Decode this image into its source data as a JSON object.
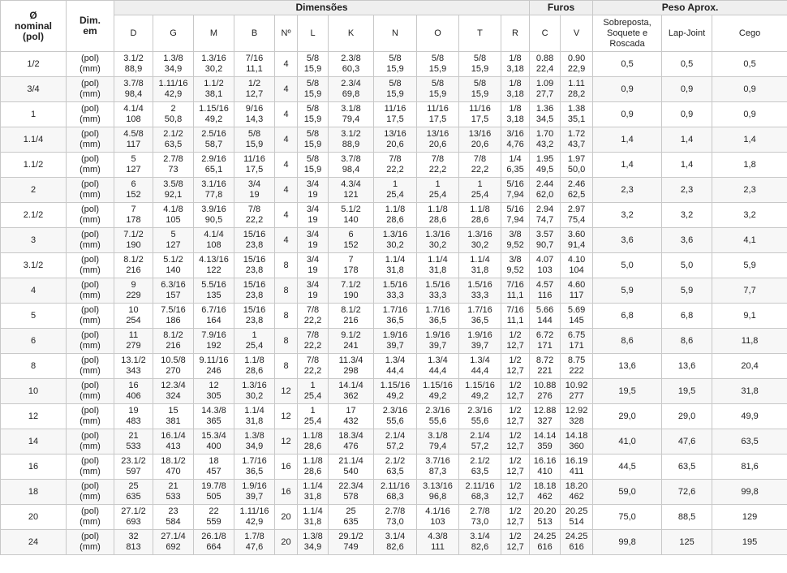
{
  "header": {
    "nominal": "Ø\nnominal\n(pol)",
    "dim": "Dim.\nem",
    "group_dimensoes": "Dimensões",
    "group_furos": "Furos",
    "group_peso": "Peso Aprox.",
    "dim_cols": [
      "D",
      "G",
      "M",
      "B",
      "Nº",
      "L",
      "K",
      "N",
      "O",
      "T",
      "R"
    ],
    "furo_cols": [
      "C",
      "V"
    ],
    "peso_cols": [
      "Sobreposta,\nSoquete e\nRoscada",
      "Lap-Joint",
      "Cego"
    ]
  },
  "units": [
    "(pol)",
    "(mm)"
  ],
  "rows": [
    {
      "n": "1/2",
      "D": [
        "3.1/2",
        "88,9"
      ],
      "G": [
        "1.3/8",
        "34,9"
      ],
      "M": [
        "1.3/16",
        "30,2"
      ],
      "B": [
        "7/16",
        "11,1"
      ],
      "No": "4",
      "L": [
        "5/8",
        "15,9"
      ],
      "K": [
        "2.3/8",
        "60,3"
      ],
      "N": [
        "5/8",
        "15,9"
      ],
      "O": [
        "5/8",
        "15,9"
      ],
      "T": [
        "5/8",
        "15,9"
      ],
      "R": [
        "1/8",
        "3,18"
      ],
      "C": [
        "0.88",
        "22,4"
      ],
      "V": [
        "0.90",
        "22,9"
      ],
      "p1": "0,5",
      "p2": "0,5",
      "p3": "0,5"
    },
    {
      "n": "3/4",
      "D": [
        "3.7/8",
        "98,4"
      ],
      "G": [
        "1.11/16",
        "42,9"
      ],
      "M": [
        "1.1/2",
        "38,1"
      ],
      "B": [
        "1/2",
        "12,7"
      ],
      "No": "4",
      "L": [
        "5/8",
        "15,9"
      ],
      "K": [
        "2.3/4",
        "69,8"
      ],
      "N": [
        "5/8",
        "15,9"
      ],
      "O": [
        "5/8",
        "15,9"
      ],
      "T": [
        "5/8",
        "15,9"
      ],
      "R": [
        "1/8",
        "3,18"
      ],
      "C": [
        "1.09",
        "27,7"
      ],
      "V": [
        "1.11",
        "28,2"
      ],
      "p1": "0,9",
      "p2": "0,9",
      "p3": "0,9"
    },
    {
      "n": "1",
      "D": [
        "4.1/4",
        "108"
      ],
      "G": [
        "2",
        "50,8"
      ],
      "M": [
        "1.15/16",
        "49,2"
      ],
      "B": [
        "9/16",
        "14,3"
      ],
      "No": "4",
      "L": [
        "5/8",
        "15,9"
      ],
      "K": [
        "3.1/8",
        "79,4"
      ],
      "N": [
        "11/16",
        "17,5"
      ],
      "O": [
        "11/16",
        "17,5"
      ],
      "T": [
        "11/16",
        "17,5"
      ],
      "R": [
        "1/8",
        "3,18"
      ],
      "C": [
        "1.36",
        "34,5"
      ],
      "V": [
        "1.38",
        "35,1"
      ],
      "p1": "0,9",
      "p2": "0,9",
      "p3": "0,9"
    },
    {
      "n": "1.1/4",
      "D": [
        "4.5/8",
        "117"
      ],
      "G": [
        "2.1/2",
        "63,5"
      ],
      "M": [
        "2.5/16",
        "58,7"
      ],
      "B": [
        "5/8",
        "15,9"
      ],
      "No": "4",
      "L": [
        "5/8",
        "15,9"
      ],
      "K": [
        "3.1/2",
        "88,9"
      ],
      "N": [
        "13/16",
        "20,6"
      ],
      "O": [
        "13/16",
        "20,6"
      ],
      "T": [
        "13/16",
        "20,6"
      ],
      "R": [
        "3/16",
        "4,76"
      ],
      "C": [
        "1.70",
        "43,2"
      ],
      "V": [
        "1.72",
        "43,7"
      ],
      "p1": "1,4",
      "p2": "1,4",
      "p3": "1,4"
    },
    {
      "n": "1.1/2",
      "D": [
        "5",
        "127"
      ],
      "G": [
        "2.7/8",
        "73"
      ],
      "M": [
        "2.9/16",
        "65,1"
      ],
      "B": [
        "11/16",
        "17,5"
      ],
      "No": "4",
      "L": [
        "5/8",
        "15,9"
      ],
      "K": [
        "3.7/8",
        "98,4"
      ],
      "N": [
        "7/8",
        "22,2"
      ],
      "O": [
        "7/8",
        "22,2"
      ],
      "T": [
        "7/8",
        "22,2"
      ],
      "R": [
        "1/4",
        "6,35"
      ],
      "C": [
        "1.95",
        "49,5"
      ],
      "V": [
        "1.97",
        "50,0"
      ],
      "p1": "1,4",
      "p2": "1,4",
      "p3": "1,8"
    },
    {
      "n": "2",
      "D": [
        "6",
        "152"
      ],
      "G": [
        "3.5/8",
        "92,1"
      ],
      "M": [
        "3.1/16",
        "77,8"
      ],
      "B": [
        "3/4",
        "19"
      ],
      "No": "4",
      "L": [
        "3/4",
        "19"
      ],
      "K": [
        "4.3/4",
        "121"
      ],
      "N": [
        "1",
        "25,4"
      ],
      "O": [
        "1",
        "25,4"
      ],
      "T": [
        "1",
        "25,4"
      ],
      "R": [
        "5/16",
        "7,94"
      ],
      "C": [
        "2.44",
        "62,0"
      ],
      "V": [
        "2.46",
        "62,5"
      ],
      "p1": "2,3",
      "p2": "2,3",
      "p3": "2,3"
    },
    {
      "n": "2.1/2",
      "D": [
        "7",
        "178"
      ],
      "G": [
        "4.1/8",
        "105"
      ],
      "M": [
        "3.9/16",
        "90,5"
      ],
      "B": [
        "7/8",
        "22,2"
      ],
      "No": "4",
      "L": [
        "3/4",
        "19"
      ],
      "K": [
        "5.1/2",
        "140"
      ],
      "N": [
        "1.1/8",
        "28,6"
      ],
      "O": [
        "1.1/8",
        "28,6"
      ],
      "T": [
        "1.1/8",
        "28,6"
      ],
      "R": [
        "5/16",
        "7,94"
      ],
      "C": [
        "2.94",
        "74,7"
      ],
      "V": [
        "2.97",
        "75,4"
      ],
      "p1": "3,2",
      "p2": "3,2",
      "p3": "3,2"
    },
    {
      "n": "3",
      "D": [
        "7.1/2",
        "190"
      ],
      "G": [
        "5",
        "127"
      ],
      "M": [
        "4.1/4",
        "108"
      ],
      "B": [
        "15/16",
        "23,8"
      ],
      "No": "4",
      "L": [
        "3/4",
        "19"
      ],
      "K": [
        "6",
        "152"
      ],
      "N": [
        "1.3/16",
        "30,2"
      ],
      "O": [
        "1.3/16",
        "30,2"
      ],
      "T": [
        "1.3/16",
        "30,2"
      ],
      "R": [
        "3/8",
        "9,52"
      ],
      "C": [
        "3.57",
        "90,7"
      ],
      "V": [
        "3.60",
        "91,4"
      ],
      "p1": "3,6",
      "p2": "3,6",
      "p3": "4,1"
    },
    {
      "n": "3.1/2",
      "D": [
        "8.1/2",
        "216"
      ],
      "G": [
        "5.1/2",
        "140"
      ],
      "M": [
        "4.13/16",
        "122"
      ],
      "B": [
        "15/16",
        "23,8"
      ],
      "No": "8",
      "L": [
        "3/4",
        "19"
      ],
      "K": [
        "7",
        "178"
      ],
      "N": [
        "1.1/4",
        "31,8"
      ],
      "O": [
        "1.1/4",
        "31,8"
      ],
      "T": [
        "1.1/4",
        "31,8"
      ],
      "R": [
        "3/8",
        "9,52"
      ],
      "C": [
        "4.07",
        "103"
      ],
      "V": [
        "4.10",
        "104"
      ],
      "p1": "5,0",
      "p2": "5,0",
      "p3": "5,9"
    },
    {
      "n": "4",
      "D": [
        "9",
        "229"
      ],
      "G": [
        "6.3/16",
        "157"
      ],
      "M": [
        "5.5/16",
        "135"
      ],
      "B": [
        "15/16",
        "23,8"
      ],
      "No": "8",
      "L": [
        "3/4",
        "19"
      ],
      "K": [
        "7.1/2",
        "190"
      ],
      "N": [
        "1.5/16",
        "33,3"
      ],
      "O": [
        "1.5/16",
        "33,3"
      ],
      "T": [
        "1.5/16",
        "33,3"
      ],
      "R": [
        "7/16",
        "11,1"
      ],
      "C": [
        "4.57",
        "116"
      ],
      "V": [
        "4.60",
        "117"
      ],
      "p1": "5,9",
      "p2": "5,9",
      "p3": "7,7"
    },
    {
      "n": "5",
      "D": [
        "10",
        "254"
      ],
      "G": [
        "7.5/16",
        "186"
      ],
      "M": [
        "6.7/16",
        "164"
      ],
      "B": [
        "15/16",
        "23,8"
      ],
      "No": "8",
      "L": [
        "7/8",
        "22,2"
      ],
      "K": [
        "8.1/2",
        "216"
      ],
      "N": [
        "1.7/16",
        "36,5"
      ],
      "O": [
        "1.7/16",
        "36,5"
      ],
      "T": [
        "1.7/16",
        "36,5"
      ],
      "R": [
        "7/16",
        "11,1"
      ],
      "C": [
        "5.66",
        "144"
      ],
      "V": [
        "5.69",
        "145"
      ],
      "p1": "6,8",
      "p2": "6,8",
      "p3": "9,1"
    },
    {
      "n": "6",
      "D": [
        "11",
        "279"
      ],
      "G": [
        "8.1/2",
        "216"
      ],
      "M": [
        "7.9/16",
        "192"
      ],
      "B": [
        "1",
        "25,4"
      ],
      "No": "8",
      "L": [
        "7/8",
        "22,2"
      ],
      "K": [
        "9.1/2",
        "241"
      ],
      "N": [
        "1.9/16",
        "39,7"
      ],
      "O": [
        "1.9/16",
        "39,7"
      ],
      "T": [
        "1.9/16",
        "39,7"
      ],
      "R": [
        "1/2",
        "12,7"
      ],
      "C": [
        "6.72",
        "171"
      ],
      "V": [
        "6.75",
        "171"
      ],
      "p1": "8,6",
      "p2": "8,6",
      "p3": "11,8"
    },
    {
      "n": "8",
      "D": [
        "13.1/2",
        "343"
      ],
      "G": [
        "10.5/8",
        "270"
      ],
      "M": [
        "9.11/16",
        "246"
      ],
      "B": [
        "1.1/8",
        "28,6"
      ],
      "No": "8",
      "L": [
        "7/8",
        "22,2"
      ],
      "K": [
        "11.3/4",
        "298"
      ],
      "N": [
        "1.3/4",
        "44,4"
      ],
      "O": [
        "1.3/4",
        "44,4"
      ],
      "T": [
        "1.3/4",
        "44,4"
      ],
      "R": [
        "1/2",
        "12,7"
      ],
      "C": [
        "8.72",
        "221"
      ],
      "V": [
        "8.75",
        "222"
      ],
      "p1": "13,6",
      "p2": "13,6",
      "p3": "20,4"
    },
    {
      "n": "10",
      "D": [
        "16",
        "406"
      ],
      "G": [
        "12.3/4",
        "324"
      ],
      "M": [
        "12",
        "305"
      ],
      "B": [
        "1.3/16",
        "30,2"
      ],
      "No": "12",
      "L": [
        "1",
        "25,4"
      ],
      "K": [
        "14.1/4",
        "362"
      ],
      "N": [
        "1.15/16",
        "49,2"
      ],
      "O": [
        "1.15/16",
        "49,2"
      ],
      "T": [
        "1.15/16",
        "49,2"
      ],
      "R": [
        "1/2",
        "12,7"
      ],
      "C": [
        "10.88",
        "276"
      ],
      "V": [
        "10.92",
        "277"
      ],
      "p1": "19,5",
      "p2": "19,5",
      "p3": "31,8"
    },
    {
      "n": "12",
      "D": [
        "19",
        "483"
      ],
      "G": [
        "15",
        "381"
      ],
      "M": [
        "14.3/8",
        "365"
      ],
      "B": [
        "1.1/4",
        "31,8"
      ],
      "No": "12",
      "L": [
        "1",
        "25,4"
      ],
      "K": [
        "17",
        "432"
      ],
      "N": [
        "2.3/16",
        "55,6"
      ],
      "O": [
        "2.3/16",
        "55,6"
      ],
      "T": [
        "2.3/16",
        "55,6"
      ],
      "R": [
        "1/2",
        "12,7"
      ],
      "C": [
        "12.88",
        "327"
      ],
      "V": [
        "12.92",
        "328"
      ],
      "p1": "29,0",
      "p2": "29,0",
      "p3": "49,9"
    },
    {
      "n": "14",
      "D": [
        "21",
        "533"
      ],
      "G": [
        "16.1/4",
        "413"
      ],
      "M": [
        "15.3/4",
        "400"
      ],
      "B": [
        "1.3/8",
        "34,9"
      ],
      "No": "12",
      "L": [
        "1.1/8",
        "28,6"
      ],
      "K": [
        "18.3/4",
        "476"
      ],
      "N": [
        "2.1/4",
        "57,2"
      ],
      "O": [
        "3.1/8",
        "79,4"
      ],
      "T": [
        "2.1/4",
        "57,2"
      ],
      "R": [
        "1/2",
        "12,7"
      ],
      "C": [
        "14.14",
        "359"
      ],
      "V": [
        "14.18",
        "360"
      ],
      "p1": "41,0",
      "p2": "47,6",
      "p3": "63,5"
    },
    {
      "n": "16",
      "D": [
        "23.1/2",
        "597"
      ],
      "G": [
        "18.1/2",
        "470"
      ],
      "M": [
        "18",
        "457"
      ],
      "B": [
        "1.7/16",
        "36,5"
      ],
      "No": "16",
      "L": [
        "1.1/8",
        "28,6"
      ],
      "K": [
        "21.1/4",
        "540"
      ],
      "N": [
        "2.1/2",
        "63,5"
      ],
      "O": [
        "3.7/16",
        "87,3"
      ],
      "T": [
        "2.1/2",
        "63,5"
      ],
      "R": [
        "1/2",
        "12,7"
      ],
      "C": [
        "16.16",
        "410"
      ],
      "V": [
        "16.19",
        "411"
      ],
      "p1": "44,5",
      "p2": "63,5",
      "p3": "81,6"
    },
    {
      "n": "18",
      "D": [
        "25",
        "635"
      ],
      "G": [
        "21",
        "533"
      ],
      "M": [
        "19.7/8",
        "505"
      ],
      "B": [
        "1.9/16",
        "39,7"
      ],
      "No": "16",
      "L": [
        "1.1/4",
        "31,8"
      ],
      "K": [
        "22.3/4",
        "578"
      ],
      "N": [
        "2.11/16",
        "68,3"
      ],
      "O": [
        "3.13/16",
        "96,8"
      ],
      "T": [
        "2.11/16",
        "68,3"
      ],
      "R": [
        "1/2",
        "12,7"
      ],
      "C": [
        "18.18",
        "462"
      ],
      "V": [
        "18.20",
        "462"
      ],
      "p1": "59,0",
      "p2": "72,6",
      "p3": "99,8"
    },
    {
      "n": "20",
      "D": [
        "27.1/2",
        "693"
      ],
      "G": [
        "23",
        "584"
      ],
      "M": [
        "22",
        "559"
      ],
      "B": [
        "1.11/16",
        "42,9"
      ],
      "No": "20",
      "L": [
        "1.1/4",
        "31,8"
      ],
      "K": [
        "25",
        "635"
      ],
      "N": [
        "2.7/8",
        "73,0"
      ],
      "O": [
        "4.1/16",
        "103"
      ],
      "T": [
        "2.7/8",
        "73,0"
      ],
      "R": [
        "1/2",
        "12,7"
      ],
      "C": [
        "20.20",
        "513"
      ],
      "V": [
        "20.25",
        "514"
      ],
      "p1": "75,0",
      "p2": "88,5",
      "p3": "129"
    },
    {
      "n": "24",
      "D": [
        "32",
        "813"
      ],
      "G": [
        "27.1/4",
        "692"
      ],
      "M": [
        "26.1/8",
        "664"
      ],
      "B": [
        "1.7/8",
        "47,6"
      ],
      "No": "20",
      "L": [
        "1.3/8",
        "34,9"
      ],
      "K": [
        "29.1/2",
        "749"
      ],
      "N": [
        "3.1/4",
        "82,6"
      ],
      "O": [
        "4.3/8",
        "111"
      ],
      "T": [
        "3.1/4",
        "82,6"
      ],
      "R": [
        "1/2",
        "12,7"
      ],
      "C": [
        "24.25",
        "616"
      ],
      "V": [
        "24.25",
        "616"
      ],
      "p1": "99,8",
      "p2": "125",
      "p3": "195"
    }
  ]
}
